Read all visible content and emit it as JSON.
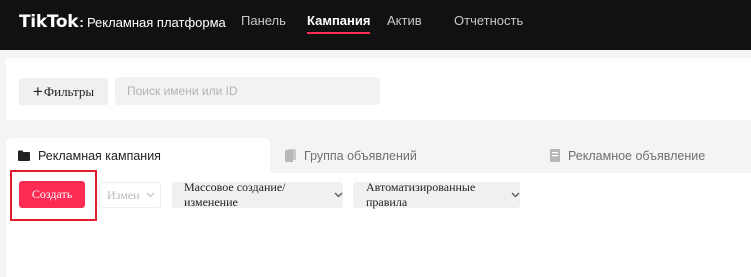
{
  "header": {
    "logo_word": "TikTok",
    "logo_colon": ":",
    "logo_subtitle": "Рекламная платформа",
    "nav": [
      {
        "label": "Панель",
        "active": false
      },
      {
        "label": "Кампания",
        "active": true
      },
      {
        "label": "Актив",
        "active": false
      },
      {
        "label": "Отчетность",
        "active": false
      }
    ]
  },
  "filters": {
    "filter_button": {
      "plus": "+",
      "label": "Фильтры"
    },
    "search": {
      "placeholder": "Поиск имени или ID",
      "value": ""
    }
  },
  "tabs": [
    {
      "label": "Рекламная кампания",
      "active": true,
      "icon": "folder-icon"
    },
    {
      "label": "Группа объявлений",
      "active": false,
      "icon": "document-stack-icon"
    },
    {
      "label": "Рекламное объявление",
      "active": false,
      "icon": "ad-document-icon"
    }
  ],
  "toolbar": {
    "create_label": "Создать",
    "edit_label": "Измен",
    "bulk_label": "Массовое создание/изменение",
    "rules_label": "Автоматизированные правила"
  },
  "colors": {
    "accent": "#fe2c55",
    "highlight_border": "#e01c2d",
    "topbar_bg": "#111111"
  }
}
